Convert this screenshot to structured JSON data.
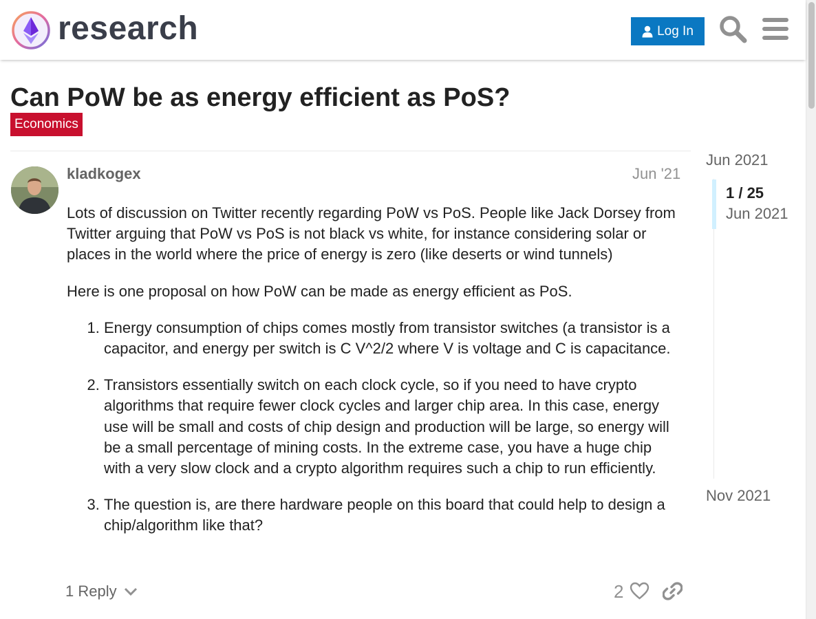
{
  "header": {
    "site_name": "research",
    "login_label": "Log In"
  },
  "topic": {
    "title": "Can PoW be as energy efficient as PoS?",
    "category": "Economics"
  },
  "post": {
    "username": "kladkogex",
    "date": "Jun '21",
    "paragraphs": [
      "Lots of discussion on Twitter recently regarding PoW vs PoS. People like Jack Dorsey from Twitter arguing that PoW vs PoS is not black vs white, for instance considering solar or places in the world where the price of energy is zero (like deserts or wind tunnels)",
      "Here is one proposal on how PoW can be made as energy efficient as PoS."
    ],
    "list_items": [
      "Energy consumption of chips comes mostly from transistor switches (a transistor is a capacitor, and energy per switch is C V^2/2 where V is voltage and C is capacitance.",
      "Transistors essentially switch on each clock cycle, so if you need to have crypto algorithms that require fewer clock cycles and larger chip area. In this case, energy use will be small and costs of chip design and production will be large, so energy will be a small percentage of mining costs. In the extreme case, you have a huge chip with a very slow clock and a crypto algorithm requires such a chip to run efficiently.",
      "The question is, are there hardware people on this board that could help to design a chip/algorithm like that?"
    ],
    "replies_label": "1 Reply",
    "like_count": "2"
  },
  "timeline": {
    "start_date": "Jun 2021",
    "position": "1 / 25",
    "position_date": "Jun 2021",
    "end_date": "Nov 2021"
  },
  "icons": {
    "logo": "research-logo-icon",
    "user": "user-icon",
    "search": "search-icon",
    "menu": "hamburger-menu-icon",
    "chevron": "chevron-down-icon",
    "heart": "heart-icon",
    "link": "link-icon"
  },
  "colors": {
    "login_button": "#0a78c2",
    "category_badge": "#c8102e",
    "timeline_handle": "#d1f0ff"
  }
}
